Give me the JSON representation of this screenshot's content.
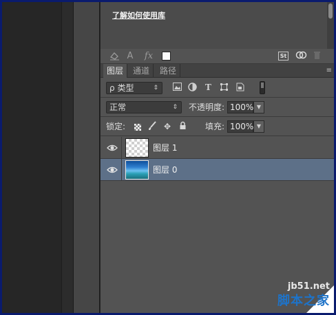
{
  "library": {
    "link_text": "了解如何使用库"
  },
  "library_tools": {
    "icons": [
      "paint-bucket-icon",
      "character-style-icon",
      "fx-icon",
      "color-swatch-icon",
      "stock-icon",
      "creative-cloud-icon",
      "trash-icon"
    ],
    "swatch_color": "#fafafa",
    "stock_label": "St",
    "char_label": "A",
    "fx_label": "fx"
  },
  "tabs": [
    {
      "label": "图层",
      "active": true
    },
    {
      "label": "通道",
      "active": false
    },
    {
      "label": "路径",
      "active": false
    }
  ],
  "filter": {
    "kind_label": "类型",
    "search_glyph": "ρ"
  },
  "blend": {
    "mode": "正常",
    "opacity_label": "不透明度:",
    "opacity_value": "100%"
  },
  "lock": {
    "label": "锁定:",
    "fill_label": "填充:",
    "fill_value": "100%"
  },
  "layers": [
    {
      "name": "图层 1",
      "selected": false,
      "thumbnail": "transparent"
    },
    {
      "name": "图层 0",
      "selected": true,
      "thumbnail": "image"
    }
  ],
  "watermark": {
    "url": "jb51.net",
    "name": "脚本之家"
  },
  "colors": {
    "selected_row": "#5d7088",
    "panel_bg": "#535353",
    "frame_border": "#0a1b6e",
    "watermark_blue": "#1e73c8"
  }
}
